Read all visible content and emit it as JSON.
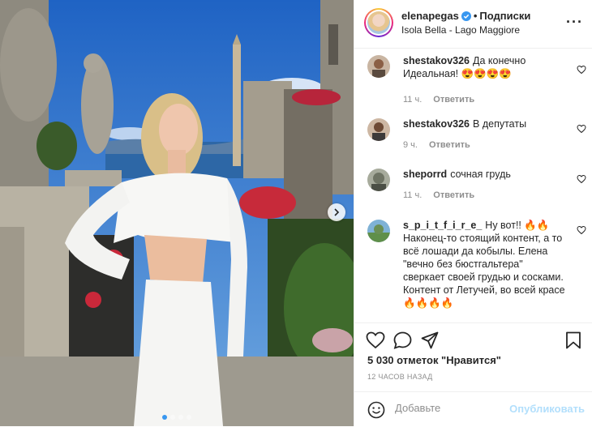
{
  "header": {
    "username": "elenapegas",
    "separator": "•",
    "follow_label": "Подписки",
    "location": "Isola Bella - Lago Maggiore",
    "more_label": "···",
    "avatar_icon": "profile-avatar"
  },
  "photo": {
    "next_icon": "chevron-right-icon",
    "slide_count": 4,
    "active_slide": 1
  },
  "comments": [
    {
      "user": "shestakov326",
      "text": "Да конечно Идеальная! 😍😍😍😍",
      "time": "11 ч.",
      "reply": "Ответить"
    },
    {
      "user": "shestakov326",
      "text": "В депутаты",
      "time": "9 ч.",
      "reply": "Ответить"
    },
    {
      "user": "sheporrd",
      "text": "сочная грудь",
      "time": "11 ч.",
      "reply": "Ответить"
    },
    {
      "user": "s_p_i_t_f_i_r_e_",
      "text": "Ну вот!! 🔥🔥 Наконец-то стоящий контент, а то всё лошади да кобылы. Елена \"вечно без бюстгальтера\" сверкает своей грудью и сосками. Контент от Летучей, во всей красе🔥🔥🔥🔥",
      "time": "",
      "reply": ""
    }
  ],
  "actions": {
    "likes": "5 030 отметок \"Нравится\"",
    "timestamp": "12 ЧАСОВ НАЗАД"
  },
  "add_comment": {
    "placeholder": "Добавьте",
    "publish_label": "Опубликовать"
  },
  "colors": {
    "accent": "#0095f6",
    "publish_disabled": "#b2dffc",
    "secondary_text": "#8e8e8e"
  }
}
